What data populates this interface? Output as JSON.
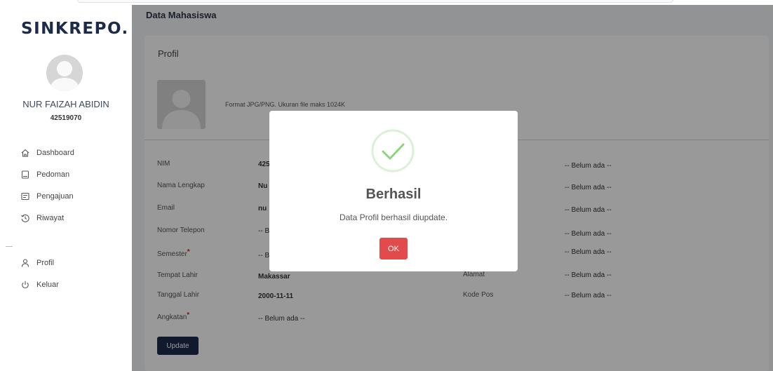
{
  "sidebar": {
    "brand": "SINKREPO.",
    "user_name": "NUR FAIZAH ABIDIN",
    "user_nim": "42519070",
    "menu": [
      {
        "label": "Dashboard",
        "icon": "home-icon"
      },
      {
        "label": "Pedoman",
        "icon": "book-icon"
      },
      {
        "label": "Pengajuan",
        "icon": "document-icon"
      },
      {
        "label": "Riwayat",
        "icon": "history-icon"
      }
    ],
    "menu2": [
      {
        "label": "Profil",
        "icon": "user-icon"
      },
      {
        "label": "Keluar",
        "icon": "power-icon"
      }
    ]
  },
  "main": {
    "title": "Data Mahasiswa",
    "card_title": "Profil",
    "photo_hint": "Format JPG/PNG. Ukuran file maks 1024K",
    "left_fields": [
      {
        "label": "NIM",
        "value": "425",
        "required": false,
        "bold": true
      },
      {
        "label": "Nama Lengkap",
        "value": "Nu",
        "required": false,
        "bold": true
      },
      {
        "label": "Email",
        "value": "nu",
        "required": false,
        "bold": true
      },
      {
        "label": "Nomor Telepon",
        "value": "-- B",
        "required": false,
        "bold": false
      },
      {
        "label": "Semester",
        "value": "-- B",
        "required": true,
        "bold": false
      },
      {
        "label": "Tempat Lahir",
        "value": "Makassar",
        "required": false,
        "bold": true
      },
      {
        "label": "Tanggal Lahir",
        "value": "2000-11-11",
        "required": false,
        "bold": true
      },
      {
        "label": "Angkatan",
        "value": "-- Belum ada --",
        "required": true,
        "bold": false
      }
    ],
    "right_fields": [
      {
        "label": "",
        "value": "-- Belum ada --"
      },
      {
        "label": "",
        "value": "-- Belum ada --"
      },
      {
        "label": "",
        "value": "-- Belum ada --"
      },
      {
        "label": "",
        "value": "-- Belum ada --"
      },
      {
        "label": "",
        "value": "-- Belum ada --"
      },
      {
        "label": "Alamat",
        "value": "-- Belum ada --"
      },
      {
        "label": "Kode Pos",
        "value": "-- Belum ada --"
      }
    ],
    "required_mark": "*",
    "update_label": "Update"
  },
  "modal": {
    "title": "Berhasil",
    "message": "Data Profil berhasil diupdate.",
    "ok_label": "OK"
  },
  "colors": {
    "brand": "#1c2b4a",
    "primary_button": "#1b2a4e",
    "ok_button": "#e14b4b",
    "success": "#8cd47e",
    "required": "#e02020"
  }
}
